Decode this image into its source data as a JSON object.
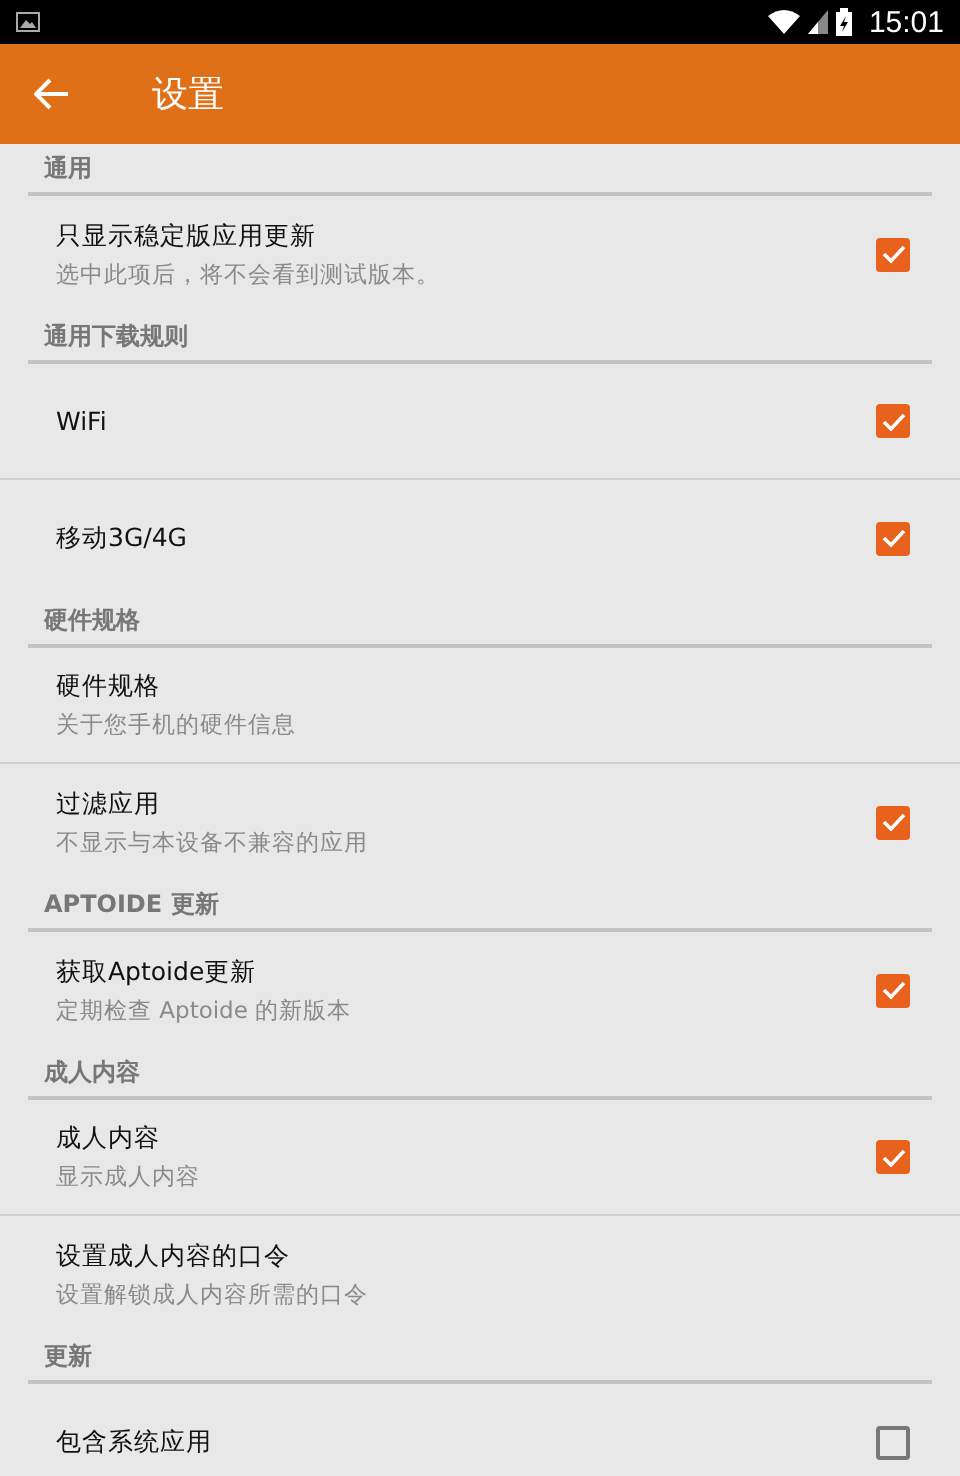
{
  "status_bar": {
    "time": "15:01"
  },
  "app_bar": {
    "title": "设置"
  },
  "sections": [
    {
      "header": "通用",
      "items": [
        {
          "kind": "checkbox",
          "title": "只显示稳定版应用更新",
          "subtitle": "选中此项后，将不会看到测试版本。",
          "checked": true,
          "divider": false
        }
      ]
    },
    {
      "header": "通用下载规则",
      "items": [
        {
          "kind": "checkbox",
          "title": "WiFi",
          "checked": true,
          "divider": true
        },
        {
          "kind": "checkbox",
          "title": "移动3G/4G",
          "checked": true,
          "divider": false
        }
      ]
    },
    {
      "header": "硬件规格",
      "items": [
        {
          "kind": "plain",
          "title": "硬件规格",
          "subtitle": "关于您手机的硬件信息",
          "divider": true
        },
        {
          "kind": "checkbox",
          "title": "过滤应用",
          "subtitle": "不显示与本设备不兼容的应用",
          "checked": true,
          "divider": false
        }
      ]
    },
    {
      "header": "APTOIDE 更新",
      "items": [
        {
          "kind": "checkbox",
          "title": "获取Aptoide更新",
          "subtitle": "定期检查 Aptoide 的新版本",
          "checked": true,
          "divider": false
        }
      ]
    },
    {
      "header": "成人内容",
      "items": [
        {
          "kind": "checkbox",
          "title": "成人内容",
          "subtitle": "显示成人内容",
          "checked": true,
          "divider": true
        },
        {
          "kind": "plain",
          "title": "设置成人内容的口令",
          "subtitle": "设置解锁成人内容所需的口令",
          "divider": false
        }
      ]
    },
    {
      "header": "更新",
      "items": [
        {
          "kind": "checkbox",
          "title": "包含系统应用",
          "checked": false,
          "divider": false
        }
      ]
    }
  ]
}
